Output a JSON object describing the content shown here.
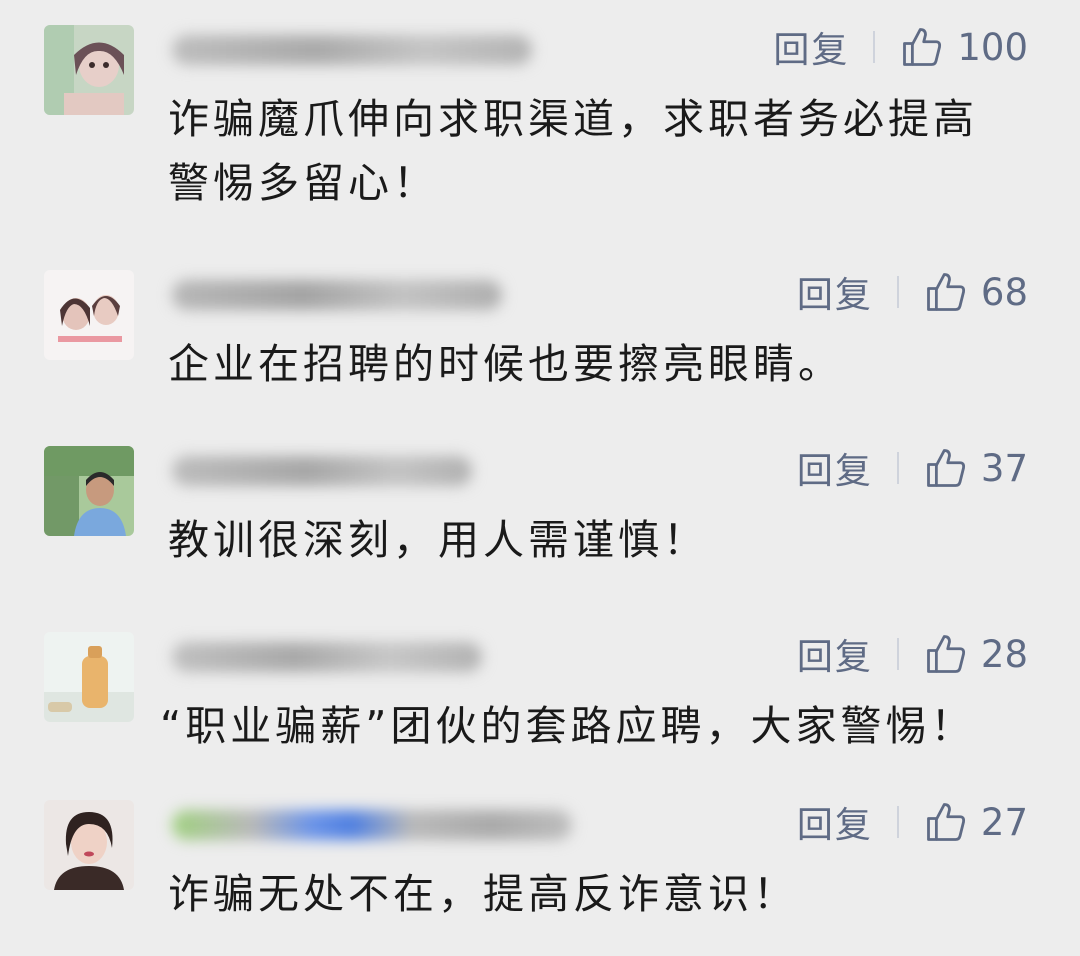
{
  "comments": [
    {
      "reply_label": "回复",
      "likes": "100",
      "text": "诈骗魔爪伸向求职渠道，求职者务必提高警惕多留心！",
      "avatar_palette": [
        "#c8d9c0",
        "#8a6f73",
        "#e9d4cf"
      ]
    },
    {
      "reply_label": "回复",
      "likes": "68",
      "text": "企业在招聘的时候也要擦亮眼睛。",
      "avatar_palette": [
        "#f4f1f1",
        "#6b4b4b",
        "#d9b7b0"
      ]
    },
    {
      "reply_label": "回复",
      "likes": "37",
      "text": "教训很深刻，用人需谨慎！",
      "avatar_palette": [
        "#9ec28f",
        "#3b5e2f",
        "#7aa6d6"
      ]
    },
    {
      "reply_label": "回复",
      "likes": "28",
      "text": "“职业骗薪”团伙的套路应聘，大家警惕！",
      "avatar_palette": [
        "#eef2f0",
        "#e8b872",
        "#d9dfda"
      ]
    },
    {
      "reply_label": "回复",
      "likes": "27",
      "text": "诈骗无处不在，提高反诈意识！",
      "avatar_palette": [
        "#e9e4e2",
        "#3a2a27",
        "#c99b87"
      ]
    }
  ],
  "colors": {
    "background": "#ededed",
    "action": "#5f6b85",
    "text": "#1a1a1a"
  }
}
